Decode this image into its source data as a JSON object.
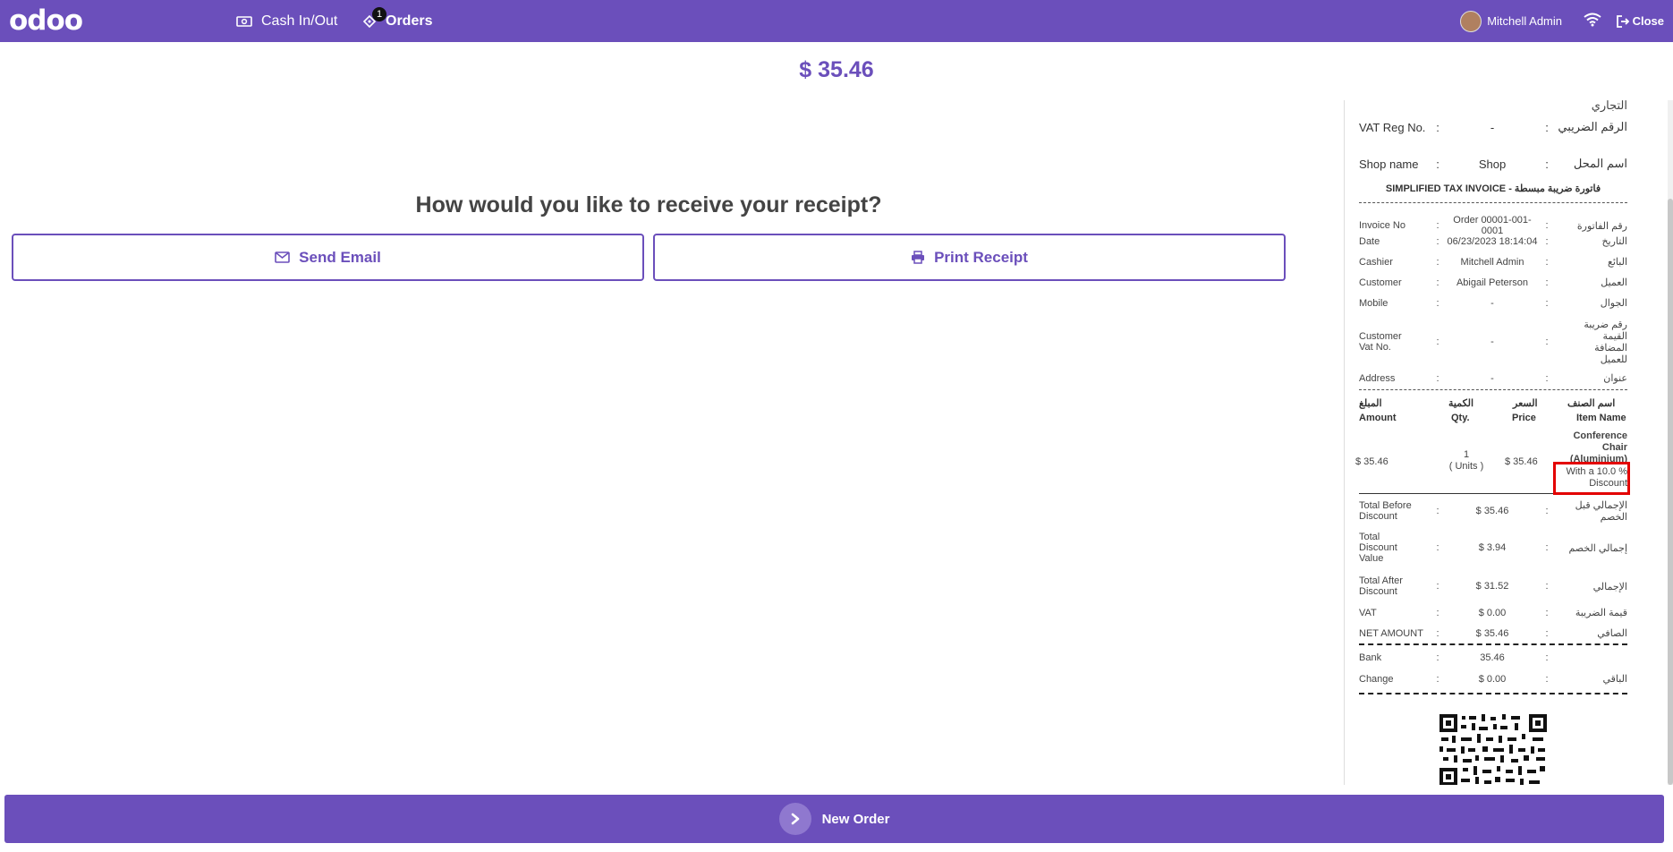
{
  "topbar": {
    "logo": "odoo",
    "cash_label": "Cash In/Out",
    "orders_label": "Orders",
    "orders_badge": "1",
    "user_name": "Mitchell Admin",
    "close_label": "Close"
  },
  "main": {
    "total": "$ 35.46",
    "question": "How would you like to receive your receipt?",
    "send_email": "Send Email",
    "print_receipt": "Print Receipt",
    "new_order": "New Order"
  },
  "receipt": {
    "cr_ar": "التجاري",
    "vat_reg_en": "VAT Reg No.",
    "vat_reg_val": "-",
    "vat_reg_ar": "الرقم الضريبي",
    "shop_en": "Shop name",
    "shop_val": "Shop",
    "shop_ar": "اسم المحل",
    "invoice_title": "SIMPLIFIED TAX INVOICE - فاتورة ضريبة مبسطة",
    "invoice_no_en": "Invoice No",
    "invoice_no_val": "Order 00001-001-0001",
    "invoice_no_ar": "رقم الفاتورة",
    "date_en": "Date",
    "date_val": "06/23/2023 18:14:04",
    "date_ar": "التاريخ",
    "cashier_en": "Cashier",
    "cashier_val": "Mitchell Admin",
    "cashier_ar": "البائع",
    "customer_en": "Customer",
    "customer_val": "Abigail Peterson",
    "customer_ar": "العميل",
    "mobile_en": "Mobile",
    "mobile_val": "-",
    "mobile_ar": "الجوال",
    "cust_vat_en": "Customer Vat No.",
    "cust_vat_val": "-",
    "cust_vat_ar": "رقم ضريبة القيمة المضافة للعميل",
    "address_en": "Address",
    "address_val": "-",
    "address_ar": "عنوان",
    "h_amount_ar": "المبلغ",
    "h_amount_en": "Amount",
    "h_qty_ar": "الكمية",
    "h_qty_en": "Qty.",
    "h_price_ar": "السعر",
    "h_price_en": "Price",
    "h_item_ar": "اسم الصنف",
    "h_item_en": "Item Name",
    "line_amount": "$ 35.46",
    "line_qty": "1",
    "line_units": "( Units )",
    "line_price": "$ 35.46",
    "line_name": "Conference Chair (Aluminium)",
    "line_discount": "With a 10.0 % Discount",
    "tbd_en": "Total Before Discount",
    "tbd_val": "$ 35.46",
    "tbd_ar": "الإجمالي قبل الخصم",
    "tdv_en": "Total Discount Value",
    "tdv_val": "$ 3.94",
    "tdv_ar": "إجمالي الخصم",
    "tad_en": "Total After Discount",
    "tad_val": "$ 31.52",
    "tad_ar": "الإجمالي",
    "vat_en": "VAT",
    "vat_val": "$ 0.00",
    "vat_ar": "قيمة الضريبة",
    "net_en": "NET AMOUNT",
    "net_val": "$ 35.46",
    "net_ar": "الصافي",
    "bank_en": "Bank",
    "bank_val": "35.46",
    "bank_ar": "",
    "change_en": "Change",
    "change_val": "$ 0.00",
    "change_ar": "الباقي",
    "sep": ":"
  }
}
